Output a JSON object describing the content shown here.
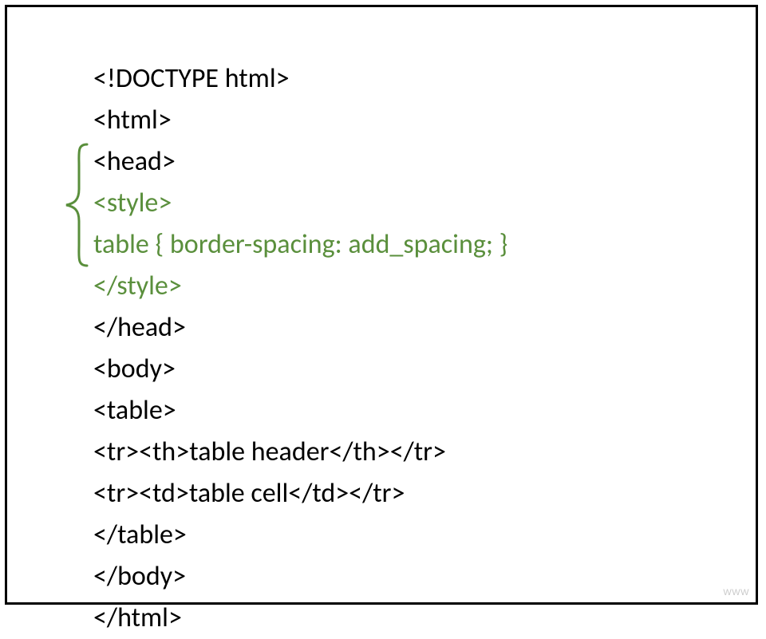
{
  "code": {
    "lines": [
      {
        "text": "<!DOCTYPE html>",
        "highlight": false
      },
      {
        "text": "<html>",
        "highlight": false
      },
      {
        "text": "<head>",
        "highlight": false
      },
      {
        "text": "<style>",
        "highlight": true
      },
      {
        "text": "table { border-spacing: add_spacing; }",
        "highlight": true
      },
      {
        "text": "</style>",
        "highlight": true
      },
      {
        "text": "</head>",
        "highlight": false
      },
      {
        "text": "<body>",
        "highlight": false
      },
      {
        "text": "<table>",
        "highlight": false
      },
      {
        "text": "<tr><th>table header</th></tr>",
        "highlight": false
      },
      {
        "text": "<tr><td>table cell</td></tr>",
        "highlight": false
      },
      {
        "text": "</table>",
        "highlight": false
      },
      {
        "text": "</body>",
        "highlight": false
      },
      {
        "text": "</html>",
        "highlight": false
      }
    ]
  },
  "colors": {
    "highlight": "#5a8f3c",
    "normal": "#000000"
  },
  "watermark": "WWW"
}
